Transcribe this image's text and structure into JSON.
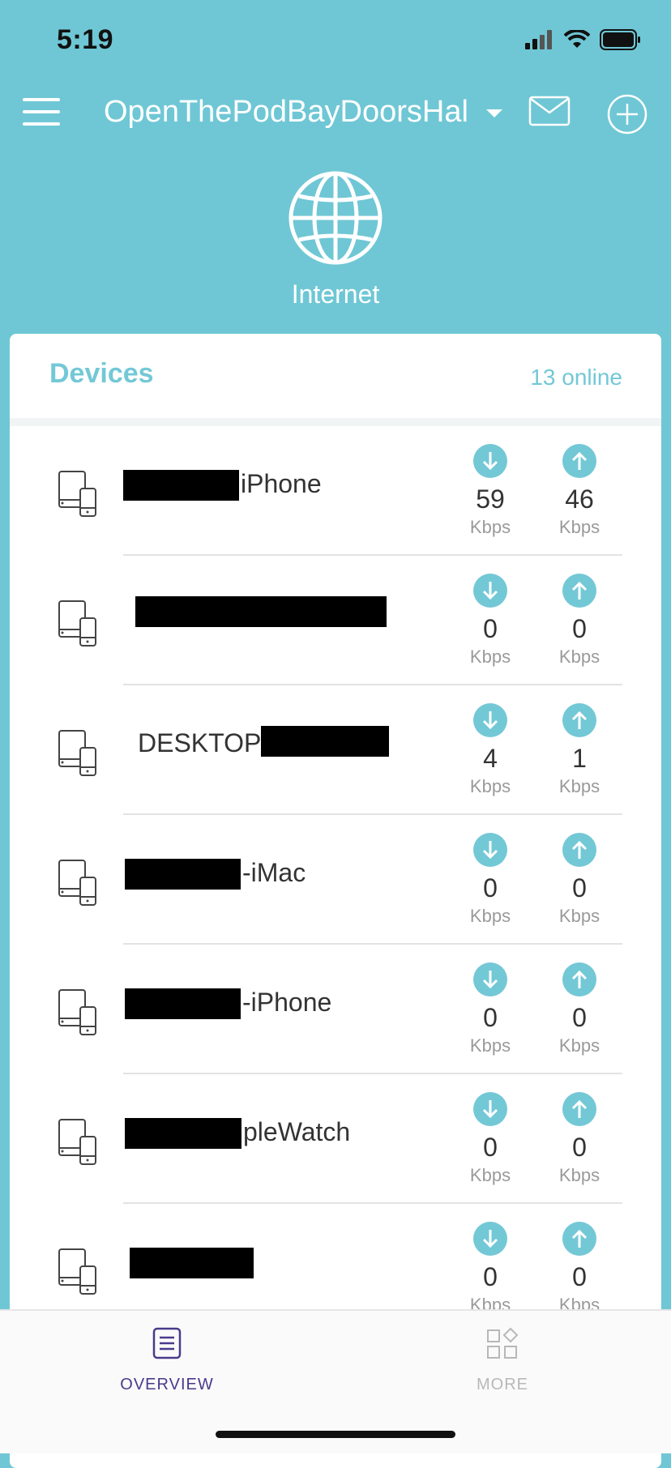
{
  "status": {
    "time": "5:19"
  },
  "header": {
    "network_name": "OpenThePodBayDoorsHal"
  },
  "internet": {
    "label": "Internet"
  },
  "devices": {
    "title": "Devices",
    "online": "13 online",
    "rows": [
      {
        "name": "iPhone",
        "down": "59",
        "up": "46",
        "unit": "Kbps"
      },
      {
        "name": "",
        "down": "0",
        "up": "0",
        "unit": "Kbps"
      },
      {
        "name": "DESKTOP",
        "down": "4",
        "up": "1",
        "unit": "Kbps"
      },
      {
        "name": "-iMac",
        "down": "0",
        "up": "0",
        "unit": "Kbps"
      },
      {
        "name": "-iPhone",
        "down": "0",
        "up": "0",
        "unit": "Kbps"
      },
      {
        "name": "pleWatch",
        "down": "0",
        "up": "0",
        "unit": "Kbps"
      },
      {
        "name": "",
        "down": "0",
        "up": "0",
        "unit": "Kbps"
      }
    ]
  },
  "tabs": {
    "overview": "OVERVIEW",
    "more": "MORE"
  },
  "colors": {
    "accent": "#73c8d6",
    "header_bg": "#6fc7d5",
    "active_tab": "#4a3a8c"
  }
}
